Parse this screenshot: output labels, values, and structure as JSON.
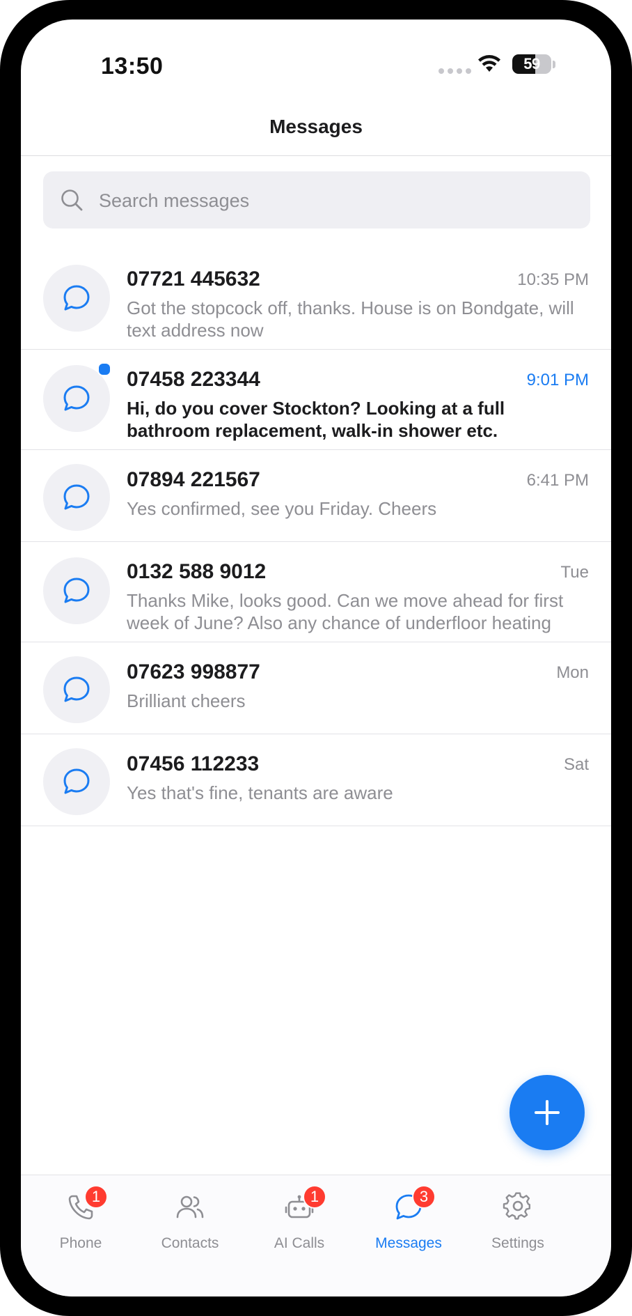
{
  "status_bar": {
    "time": "13:50",
    "battery": "59"
  },
  "header": {
    "title": "Messages"
  },
  "search": {
    "placeholder": "Search messages"
  },
  "conversations": [
    {
      "name": "07721 445632",
      "time": "10:35 PM",
      "preview": "Got the stopcock off, thanks. House is on Bondgate, will text address now",
      "unread": false
    },
    {
      "name": "07458 223344",
      "time": "9:01 PM",
      "preview": "Hi, do you cover Stockton? Looking at a full bathroom replacement, walk-in shower etc.",
      "unread": true
    },
    {
      "name": "07894 221567",
      "time": "6:41 PM",
      "preview": "Yes confirmed, see you Friday. Cheers",
      "unread": false
    },
    {
      "name": "0132 588 9012",
      "time": "Tue",
      "preview": "Thanks Mike, looks good. Can we move ahead for first week of June? Also any chance of underfloor heating",
      "unread": false
    },
    {
      "name": "07623 998877",
      "time": "Mon",
      "preview": "Brilliant cheers",
      "unread": false
    },
    {
      "name": "07456 112233",
      "time": "Sat",
      "preview": "Yes that's fine, tenants are aware",
      "unread": false
    }
  ],
  "fab": {
    "icon": "plus-icon"
  },
  "tabs": [
    {
      "label": "Phone",
      "icon": "phone-icon",
      "badge": "1",
      "active": false
    },
    {
      "label": "Contacts",
      "icon": "contacts-icon",
      "badge": null,
      "active": false
    },
    {
      "label": "AI Calls",
      "icon": "robot-icon",
      "badge": "1",
      "active": false
    },
    {
      "label": "Messages",
      "icon": "chat-bubble-icon",
      "badge": "3",
      "active": true
    },
    {
      "label": "Settings",
      "icon": "gear-icon",
      "badge": null,
      "active": false
    }
  ],
  "colors": {
    "accent": "#1a7cf2",
    "badge": "#ff3b30",
    "secondary_text": "#8e8e93"
  }
}
